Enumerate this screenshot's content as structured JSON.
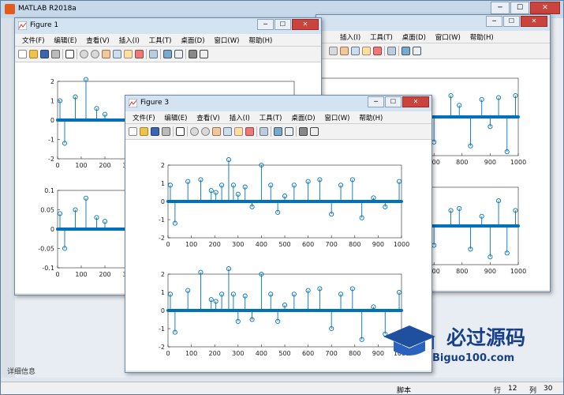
{
  "app": {
    "title": "MATLAB R2018a",
    "detail_label": "详细信息",
    "status": {
      "script": "脚本",
      "row_label": "行",
      "row_value": "12",
      "col_label": "列",
      "col_value": "30"
    }
  },
  "figure_menu": [
    "文件(F)",
    "编辑(E)",
    "查看(V)",
    "插入(I)",
    "工具(T)",
    "桌面(D)",
    "窗口(W)",
    "帮助(H)"
  ],
  "figures": {
    "fig1": {
      "title": "Figure 1"
    },
    "fig3": {
      "title": "Figure 3"
    }
  },
  "window_buttons": {
    "minimize": "─",
    "maximize": "☐",
    "close": "✕"
  },
  "watermark": {
    "text": "必过源码",
    "url": "Biguo100.com"
  },
  "icons": [
    "new-file-icon",
    "open-file-icon",
    "save-icon",
    "print-icon",
    "pointer-icon",
    "zoom-in-icon",
    "zoom-out-icon",
    "pan-icon",
    "rotate-icon",
    "data-cursor-icon",
    "brush-icon",
    "link-icon",
    "colorbar-icon",
    "legend-icon",
    "hide-plot-tools-icon",
    "show-plot-tools-icon"
  ],
  "colors": {
    "stem": "#0072bd",
    "title_bar": "#d4e3f2"
  },
  "chart_data": [
    {
      "type": "stem",
      "figure": "Figure 3 (top subplot)",
      "x": [
        10,
        30,
        85,
        140,
        185,
        205,
        230,
        260,
        280,
        300,
        330,
        360,
        400,
        440,
        470,
        500,
        540,
        600,
        650,
        700,
        740,
        790,
        830,
        880,
        930,
        990
      ],
      "y": [
        0.9,
        -1.2,
        1.1,
        1.2,
        0.6,
        0.5,
        0.9,
        2.3,
        0.9,
        0.4,
        0.8,
        -0.3,
        2.0,
        0.9,
        -0.6,
        0.3,
        0.9,
        1.1,
        1.2,
        -0.7,
        0.9,
        1.2,
        -0.9,
        0.2,
        -0.3,
        1.1
      ],
      "xlim": [
        0,
        1000
      ],
      "ylim": [
        -2,
        2
      ],
      "xticks": [
        "0",
        "100",
        "200",
        "300",
        "400",
        "500",
        "600",
        "700",
        "800",
        "900",
        "1000"
      ],
      "yticks": [
        "2",
        "1",
        "0",
        "-1",
        "-2"
      ]
    },
    {
      "type": "stem",
      "figure": "Figure 3 (bottom subplot)",
      "x": [
        10,
        30,
        85,
        140,
        185,
        205,
        230,
        260,
        280,
        300,
        330,
        360,
        400,
        440,
        470,
        500,
        540,
        600,
        650,
        700,
        740,
        790,
        830,
        880,
        930,
        990
      ],
      "y": [
        0.9,
        -1.2,
        1.1,
        2.1,
        0.6,
        0.5,
        0.9,
        2.3,
        0.9,
        -0.6,
        0.8,
        -0.5,
        2.0,
        0.9,
        -0.6,
        0.3,
        0.9,
        1.1,
        1.2,
        -1.0,
        0.9,
        1.2,
        -1.6,
        0.2,
        -1.3,
        1.0
      ],
      "xlim": [
        0,
        1000
      ],
      "ylim": [
        -2,
        2
      ],
      "xticks": [
        "0",
        "100",
        "200",
        "300",
        "400",
        "500",
        "600",
        "700",
        "800",
        "900",
        "1000"
      ],
      "yticks": [
        "2",
        "1",
        "0",
        "-1",
        "-2"
      ]
    },
    {
      "type": "stem",
      "figure": "Figure 1 (top subplot)",
      "x": [
        10,
        30,
        75,
        120,
        165,
        200
      ],
      "y": [
        1.0,
        -1.2,
        1.2,
        2.1,
        0.6,
        0.3
      ],
      "xlim": [
        0,
        1000
      ],
      "ylim": [
        -2,
        2
      ],
      "xticks": [
        "0",
        "100",
        "200",
        "300"
      ],
      "yticks": [
        "2",
        "1",
        "0",
        "-1",
        "-2"
      ]
    },
    {
      "type": "stem",
      "figure": "Figure 1 (bottom subplot)",
      "x": [
        10,
        30,
        75,
        120,
        165,
        200
      ],
      "y": [
        0.04,
        -0.05,
        0.05,
        0.08,
        0.03,
        0.02
      ],
      "xlim": [
        0,
        1000
      ],
      "ylim": [
        -0.1,
        0.1
      ],
      "xticks": [
        "0",
        "100",
        "200",
        "300"
      ],
      "yticks": [
        "0.1",
        "0.05",
        "0",
        "-0.05",
        "-0.1"
      ]
    },
    {
      "type": "stem",
      "figure": "Figure 2 (partly hidden, top subplot)",
      "x": [
        700,
        760,
        790,
        830,
        870,
        900,
        930,
        960,
        990
      ],
      "y": [
        -1.3,
        1.1,
        0.6,
        -1.5,
        0.9,
        -0.5,
        1.0,
        -1.8,
        1.1
      ],
      "xlim": [
        0,
        1000
      ],
      "ylim": [
        -2,
        2
      ],
      "xticks": [
        "700",
        "800",
        "900",
        "1000"
      ]
    },
    {
      "type": "stem",
      "figure": "Figure 2 (partly hidden, bottom subplot)",
      "x": [
        700,
        760,
        790,
        830,
        870,
        900,
        930,
        960,
        990
      ],
      "y": [
        -1.0,
        0.8,
        0.9,
        -1.2,
        0.5,
        -1.6,
        1.3,
        -1.4,
        0.8
      ],
      "xlim": [
        0,
        1000
      ],
      "ylim": [
        -2,
        2
      ],
      "xticks": [
        "700",
        "800",
        "900",
        "1000"
      ]
    }
  ]
}
